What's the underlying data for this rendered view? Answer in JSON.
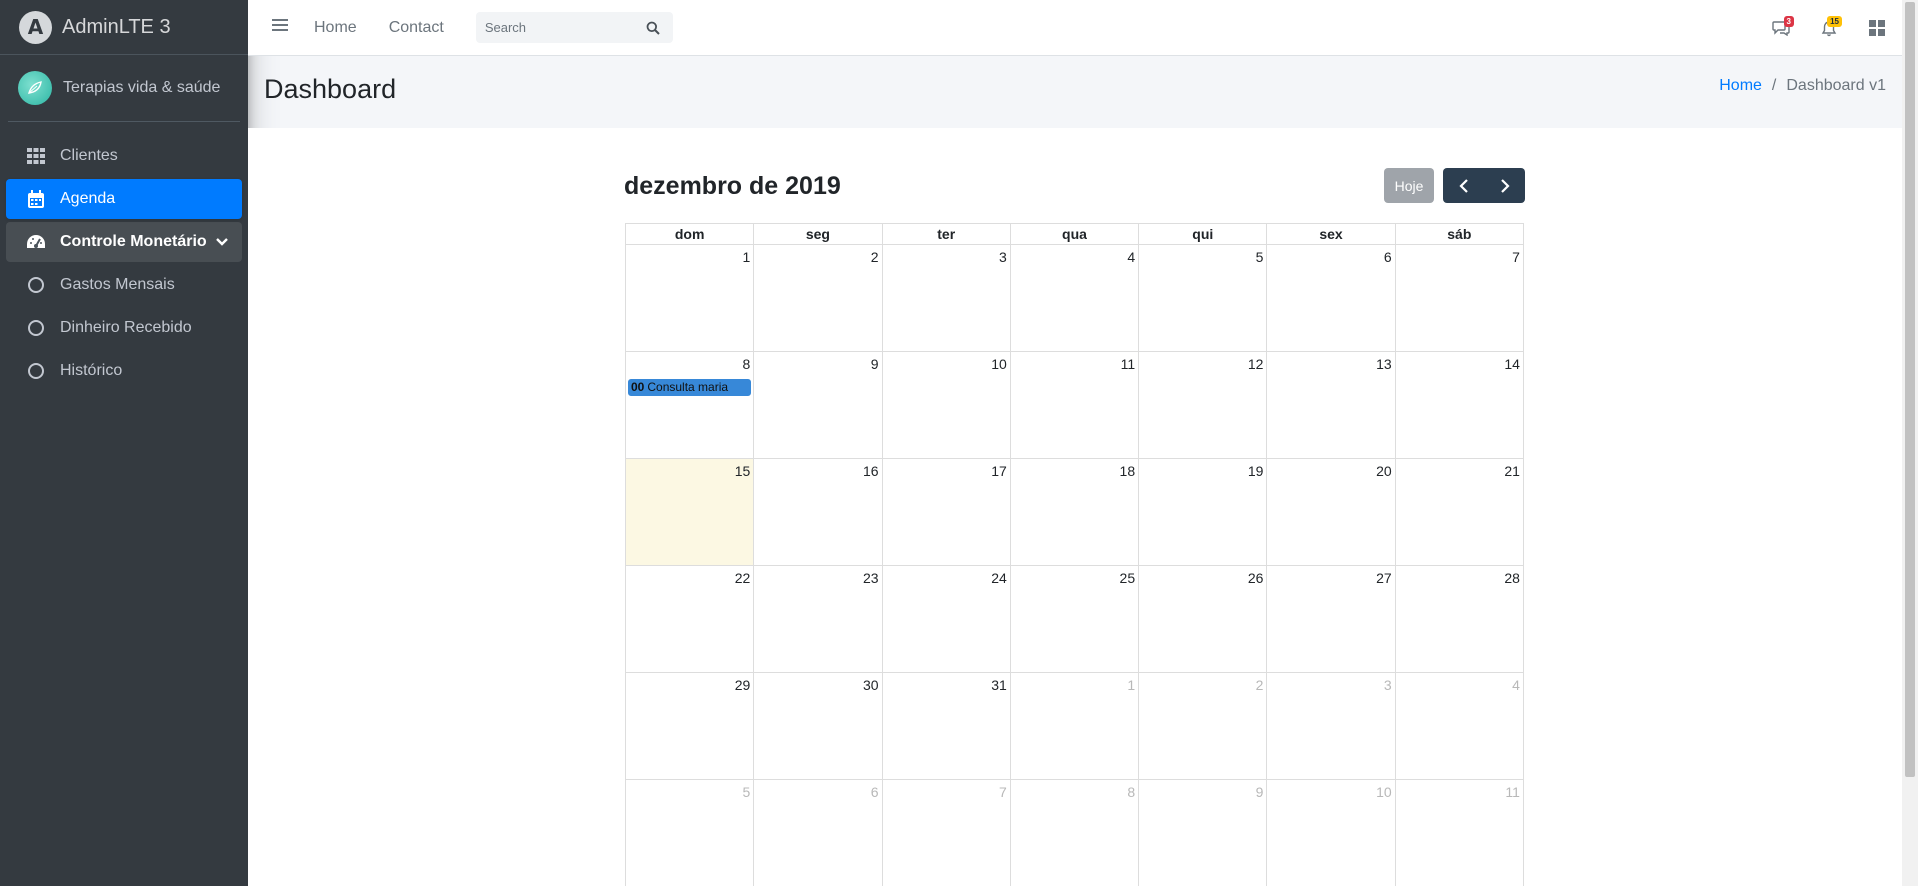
{
  "brand": {
    "logo": "A",
    "name": "AdminLTE 3"
  },
  "user": {
    "name": "Terapias vida & saúde"
  },
  "sidebar": {
    "items": [
      {
        "label": "Clientes",
        "icon": "table-grid-icon"
      },
      {
        "label": "Agenda",
        "icon": "calendar-icon"
      },
      {
        "label": "Controle Monetário",
        "icon": "tachometer-icon"
      },
      {
        "label": "Gastos Mensais",
        "icon": "circle-icon"
      },
      {
        "label": "Dinheiro Recebido",
        "icon": "circle-icon"
      },
      {
        "label": "Histórico",
        "icon": "circle-icon"
      }
    ]
  },
  "topnav": {
    "home": "Home",
    "contact": "Contact",
    "search_placeholder": "Search",
    "messages_count": "3",
    "notifications_count": "15"
  },
  "header": {
    "title": "Dashboard",
    "breadcrumb_home": "Home",
    "breadcrumb_sep": "/",
    "breadcrumb_current": "Dashboard v1"
  },
  "calendar": {
    "title": "dezembro de 2019",
    "today_label": "Hoje",
    "weekdays": [
      "dom",
      "seg",
      "ter",
      "qua",
      "qui",
      "sex",
      "sáb"
    ],
    "weeks": [
      [
        "1",
        "2",
        "3",
        "4",
        "5",
        "6",
        "7"
      ],
      [
        "8",
        "9",
        "10",
        "11",
        "12",
        "13",
        "14"
      ],
      [
        "15",
        "16",
        "17",
        "18",
        "19",
        "20",
        "21"
      ],
      [
        "22",
        "23",
        "24",
        "25",
        "26",
        "27",
        "28"
      ],
      [
        "29",
        "30",
        "31",
        "1",
        "2",
        "3",
        "4"
      ],
      [
        "5",
        "6",
        "7",
        "8",
        "9",
        "10",
        "11"
      ]
    ],
    "event": {
      "time": "00",
      "title": "Consulta maria"
    }
  },
  "colors": {
    "sidebar_bg": "#343a40",
    "active": "#007bff",
    "event": "#3788d8",
    "today_bg": "#fcf8e3",
    "nav_button": "#2c3e50"
  }
}
